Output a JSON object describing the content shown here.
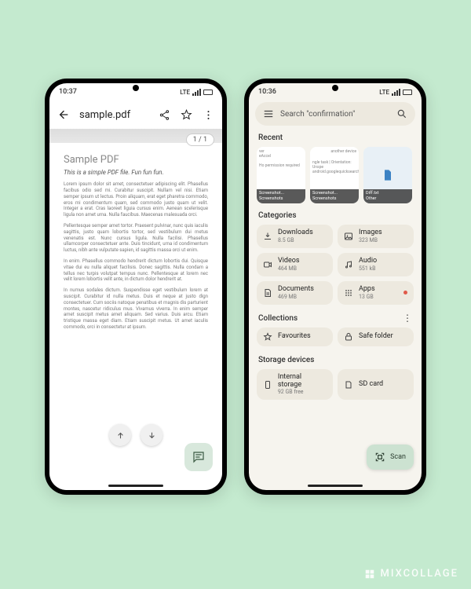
{
  "watermark": "MIXCOLLAGE",
  "phone1": {
    "status_time": "10:37",
    "status_net": "LTE",
    "title": "sample.pdf",
    "page_indicator": "1 / 1",
    "doc_heading": "Sample PDF",
    "doc_sub": "This is a simple PDF file. Fun fun fun.",
    "lorem1": "Lorem ipsum dolor sit amet, consectetuer adipiscing elit. Phasellus facibus odio sed mi. Curabitur suscipit. Nullam vel nisi. Etiam semper ipsum ut lectus. Proin aliquam, erat eget pharetra commodo, eros mi condimentum quam, sed commodo justo quam ut velit. Integer a erat. Cras laoreet liguia cursus enim. Aenean scelerisque ligula non amet urna. Nulla faucibus. Maecenas malesuada orci.",
    "lorem2": "Pellentesque semper amet tortor. Praesent pulvinar, nunc quis iaculis sagittis, justo quam lobortis tortor, sed vestibulum dui metus venenatis est. Nunc cursus ligula. Nulla facilisi. Phasellus ullamcorper consectetuer ante. Duis tincidunt, urna id condimentum luctus, nibh ante vulputate sapien, id sagittis massa orci ut enim.",
    "lorem3": "In enim. Phasellus commodo hendrerit dictum lobortis dui. Quisque vitae dui eu nulla aliquet facilisis. Donec sagittis. Nulla condam a tellus nec turpis volutpat tempus nunc. Pellentesque at lorem nec velit lorem lobortis velit ante, in dictum dolor hendrerit at.",
    "lorem4": "In numus sodales dictum. Suspendisse eget vestibulum lorem at suscipit. Curabitur id nulla metus. Duis et neque at justo dign consectetuer. Cum sociis natoque penatibus et magnis dis parturient montes, nascetur ridiculus mus. Vivamus viverra. In enim semper amet suscipit metus amet aliquam. Sed varius. Duis arcu. Etiam tristique massa eget diam. Etiam suscipit metus. Ut amet iaculis commodo, orci in consectetur at ipsum."
  },
  "phone2": {
    "status_time": "10:36",
    "status_net": "LTE",
    "search_placeholder": "Search \"confirmation\"",
    "sec_recent": "Recent",
    "sec_categories": "Categories",
    "sec_collections": "Collections",
    "sec_storage": "Storage devices",
    "recent": [
      {
        "line1": "ver",
        "line2": "eAccel",
        "line3": "Ho permission required",
        "title": "Screenshot...",
        "sub": "Screenshots"
      },
      {
        "line1": "another device",
        "line2": "ngle task | Orientation: Unspe",
        "line3": "android.googlequicksearchbox",
        "title": "Screenshot...",
        "sub": "Screenshots"
      },
      {
        "title": "Diff.txt",
        "sub": "Other"
      }
    ],
    "categories": [
      {
        "icon": "download",
        "title": "Downloads",
        "sub": "8.5 GB"
      },
      {
        "icon": "image",
        "title": "Images",
        "sub": "323 MB"
      },
      {
        "icon": "video",
        "title": "Videos",
        "sub": "464 MB"
      },
      {
        "icon": "audio",
        "title": "Audio",
        "sub": "551 kB"
      },
      {
        "icon": "doc",
        "title": "Documents",
        "sub": "469 MB"
      },
      {
        "icon": "apps",
        "title": "Apps",
        "sub": "13 GB",
        "dot": true
      }
    ],
    "collections": [
      {
        "icon": "star",
        "title": "Favourites"
      },
      {
        "icon": "lock",
        "title": "Safe folder"
      }
    ],
    "storage": [
      {
        "icon": "phone",
        "title": "Internal storage",
        "sub": "92 GB free"
      },
      {
        "icon": "sd",
        "title": "SD card",
        "sub": ""
      }
    ],
    "scan_label": "Scan"
  }
}
